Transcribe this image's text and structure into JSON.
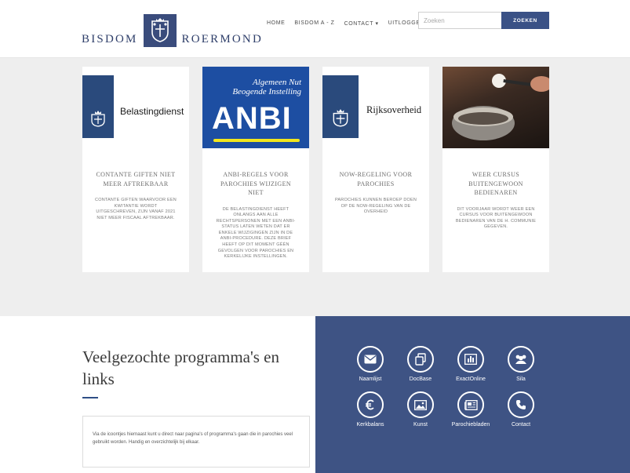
{
  "header": {
    "logo_left": "BISDOM",
    "logo_right": "ROERMOND",
    "nav": [
      "HOME",
      "BISDOM A - Z",
      "CONTACT ▾",
      "UITLOGGEN"
    ],
    "search_placeholder": "Zoeken",
    "search_button": "ZOEKEN",
    "accent_color": "#3a5186"
  },
  "news": [
    {
      "image": {
        "kind": "belastingdienst",
        "text": "Belastingdienst"
      },
      "title": "CONTANTE GIFTEN NIET MEER AFTREKBAAR",
      "text": "CONTANTE GIFTEN WAARVOOR EEN KWITANTIE WORDT UITGESCHREVEN, ZIJN VANAF 2021 NIET MEER FISCAAL AFTREKBAAR."
    },
    {
      "image": {
        "kind": "anbi",
        "top_line1": "Algemeen Nut",
        "top_line2": "Beogende Instelling",
        "big": "ANBI"
      },
      "title": "ANBI-REGELS VOOR PAROCHIES WIJZIGEN NIET",
      "text": "DE BELASTINGDIENST HEEFT ONLANGS AAN ALLE RECHTSPERSONEN MET EEN ANBI-STATUS LATEN WETEN DAT ER ENKELE WIJZIGINGEN ZIJN IN DE ANBI-PROCEDURE. DEZE BRIEF HEEFT OP DIT MOMENT GÉÉN GEVOLGEN VOOR PAROCHIES EN KERKELIJKE INSTELLINGEN."
    },
    {
      "image": {
        "kind": "rijksoverheid",
        "text": "Rijksoverheid"
      },
      "title": "NOW-REGELING VOOR PAROCHIES",
      "text": "PAROCHIES KUNNEN BEROEP DOEN OP DE NOW-REGELING VAN DE OVERHEID"
    },
    {
      "image": {
        "kind": "photo"
      },
      "title": "WEER CURSUS BUITENGEWOON BEDIENAREN",
      "text": "DIT VOORJAAR WORDT WEER EEN CURSUS VOOR BUITENGEWOON BEDIENAREN VAN DE H. COMMUNIE GEGEVEN."
    }
  ],
  "links": {
    "title": "Veelgezochte programma's en links",
    "description": "Via de icoontjes hiernaast kunt u direct naar pagina's of programma's gaan die in parochies veel gebruikt worden. Handig en overzichtelijk bij elkaar.",
    "panel_color": "#3e5384",
    "items": [
      {
        "label": "Naamlijst",
        "icon": "envelope-icon"
      },
      {
        "label": "DocBase",
        "icon": "documents-icon"
      },
      {
        "label": "ExactOnline",
        "icon": "bar-chart-icon"
      },
      {
        "label": "Sila",
        "icon": "users-icon"
      },
      {
        "label": "Kerkbalans",
        "icon": "euro-icon"
      },
      {
        "label": "Kunst",
        "icon": "picture-icon"
      },
      {
        "label": "Parochiebladen",
        "icon": "newspaper-icon"
      },
      {
        "label": "Contact",
        "icon": "phone-icon"
      }
    ]
  }
}
